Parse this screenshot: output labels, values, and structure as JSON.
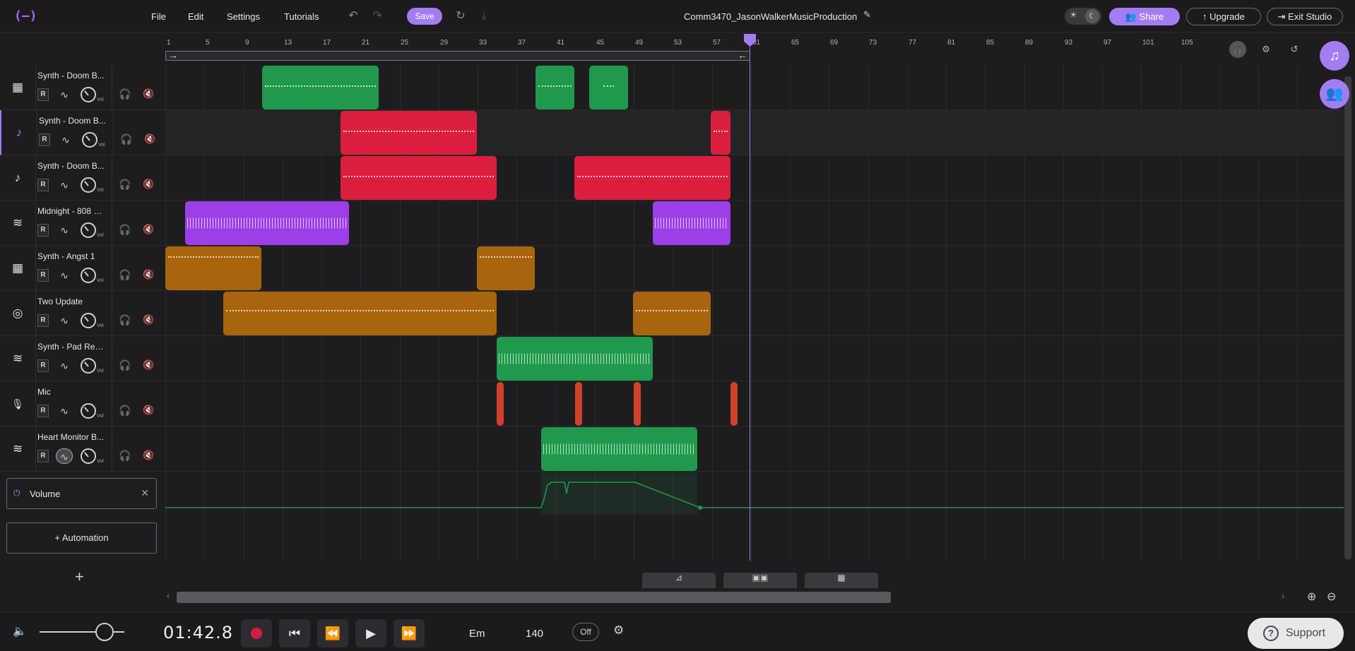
{
  "header": {
    "logo": "(—)",
    "menu": [
      "File",
      "Edit",
      "Settings",
      "Tutorials"
    ],
    "save_label": "Save",
    "project_title": "Comm3470_JasonWalkerMusicProduction",
    "share_label": "Share",
    "upgrade_label": "Upgrade",
    "exit_label": "Exit Studio"
  },
  "ruler": {
    "bars": [
      "1",
      "5",
      "9",
      "13",
      "17",
      "21",
      "25",
      "29",
      "33",
      "37",
      "41",
      "45",
      "49",
      "53",
      "57",
      "61",
      "65",
      "69",
      "73",
      "77",
      "81",
      "85",
      "89",
      "93",
      "97",
      "101",
      "105"
    ]
  },
  "tracks": [
    {
      "name": "Synth - Doom B...",
      "icon": "keyboard-icon",
      "glyph": "▦"
    },
    {
      "name": "Synth - Doom B...",
      "icon": "guitar-icon",
      "glyph": "♪"
    },
    {
      "name": "Synth - Doom B...",
      "icon": "guitar-icon",
      "glyph": "♪"
    },
    {
      "name": "Midnight - 808 &...",
      "icon": "waveform-icon",
      "glyph": "≋"
    },
    {
      "name": "Synth - Angst 1",
      "icon": "keyboard-icon",
      "glyph": "▦"
    },
    {
      "name": "Two Update",
      "icon": "drum-icon",
      "glyph": "◎"
    },
    {
      "name": "Synth - Pad Ree...",
      "icon": "waveform-icon",
      "glyph": "≋"
    },
    {
      "name": "Mic",
      "icon": "microphone-icon",
      "glyph": "🎙"
    },
    {
      "name": "Heart Monitor B...",
      "icon": "waveform-icon",
      "glyph": "≋"
    }
  ],
  "track_controls": {
    "record": "R",
    "vol": "Vol"
  },
  "automation": {
    "lane_label": "Volume",
    "add_label": "+ Automation",
    "add_track": "+"
  },
  "colors": {
    "green": "#1f9a4c",
    "red": "#dc1e3e",
    "purple": "#9c3fe6",
    "orange": "#a8650e",
    "accent": "#a47cf2"
  },
  "transport": {
    "time": "01:42.8",
    "key": "Em",
    "bpm": "140",
    "metronome": "Off",
    "support_label": "Support"
  }
}
